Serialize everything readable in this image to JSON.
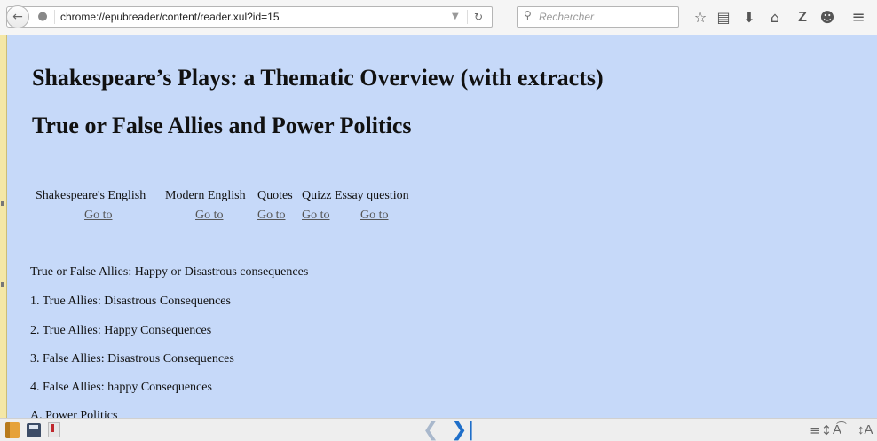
{
  "browser": {
    "url": "chrome://epubreader/content/reader.xul?id=15",
    "search_placeholder": "Rechercher",
    "icons": [
      "back-arrow-icon",
      "globe-icon",
      "dropdown-icon",
      "reload-icon",
      "search-icon",
      "star-icon",
      "reading-list-icon",
      "download-icon",
      "home-icon",
      "zotero-icon",
      "chat-icon",
      "menu-icon"
    ]
  },
  "document": {
    "title": "Shakespeare’s Plays: a Thematic Overview (with extracts)",
    "subtitle": "True or False Allies and Power Politics",
    "nav_columns": [
      {
        "header": "Shakespeare's English",
        "link": "Go to"
      },
      {
        "header": "Modern English",
        "link": "Go to"
      },
      {
        "header": "Quotes",
        "link": "Go to"
      },
      {
        "header": "Quizz",
        "link": "Go to"
      },
      {
        "header": "Essay question",
        "link": "Go to"
      }
    ],
    "toc": [
      "True or False Allies: Happy or Disastrous consequences",
      "1. True Allies: Disastrous Consequences",
      "2. True Allies: Happy Consequences",
      "3. False Allies: Disastrous Consequences",
      "4. False Allies: happy Consequences",
      "A. Power Politics"
    ]
  },
  "reader_bar": {
    "icons": [
      "library-icon",
      "save-icon",
      "pdf-icon",
      "previous-page-icon",
      "next-page-icon",
      "line-spacing-icon",
      "font-size-icon",
      "font-size-alt-icon"
    ]
  },
  "colors": {
    "page_background": "#c6d9f9",
    "link": "#555555",
    "next_arrow": "#1f6fc9"
  }
}
